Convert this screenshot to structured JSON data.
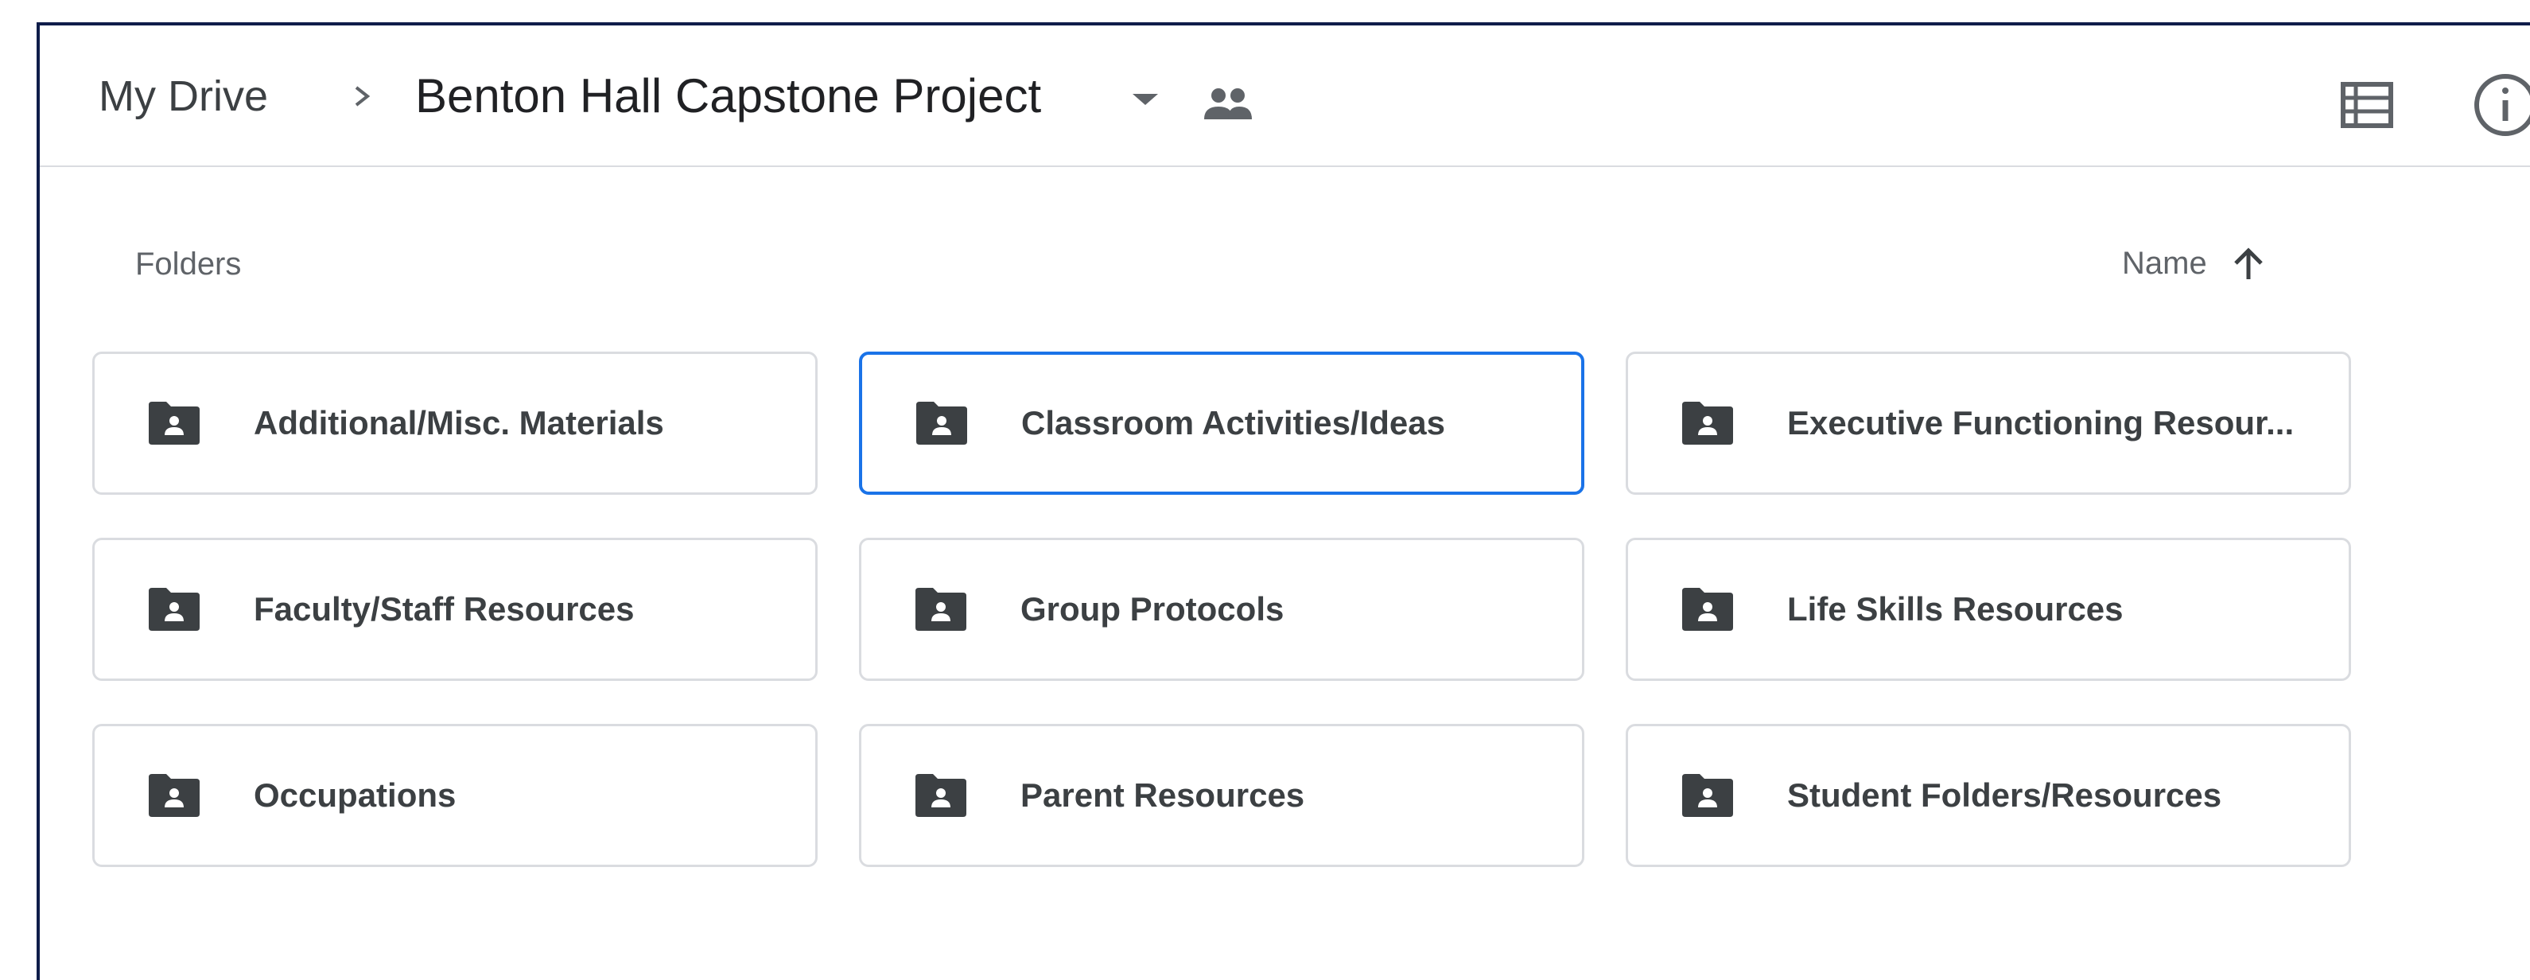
{
  "breadcrumb": {
    "root": "My Drive",
    "current": "Benton Hall Capstone Project"
  },
  "icons": {
    "separator": "chevron-right-icon",
    "caret": "caret-down-icon",
    "shared": "people-icon",
    "view": "list-view-icon",
    "info": "info-icon",
    "folder": "shared-folder-icon",
    "sort": "arrow-up-icon"
  },
  "folders_section": {
    "label": "Folders",
    "sort_label": "Name",
    "sort_direction": "ascending",
    "items": [
      {
        "name": "Additional/Misc. Materials",
        "selected": false
      },
      {
        "name": "Classroom Activities/Ideas",
        "selected": true
      },
      {
        "name": "Executive Functioning Resour...",
        "selected": false
      },
      {
        "name": "Faculty/Staff Resources",
        "selected": false
      },
      {
        "name": "Group Protocols",
        "selected": false
      },
      {
        "name": "Life Skills Resources",
        "selected": false
      },
      {
        "name": "Occupations",
        "selected": false
      },
      {
        "name": "Parent Resources",
        "selected": false
      },
      {
        "name": "Student Folders/Resources",
        "selected": false
      }
    ]
  },
  "colors": {
    "frame_border": "#0f1d4a",
    "selection": "#1a73e8",
    "icon": "#5f6368",
    "folder_icon": "#3c4043",
    "card_border": "#dadce0"
  }
}
